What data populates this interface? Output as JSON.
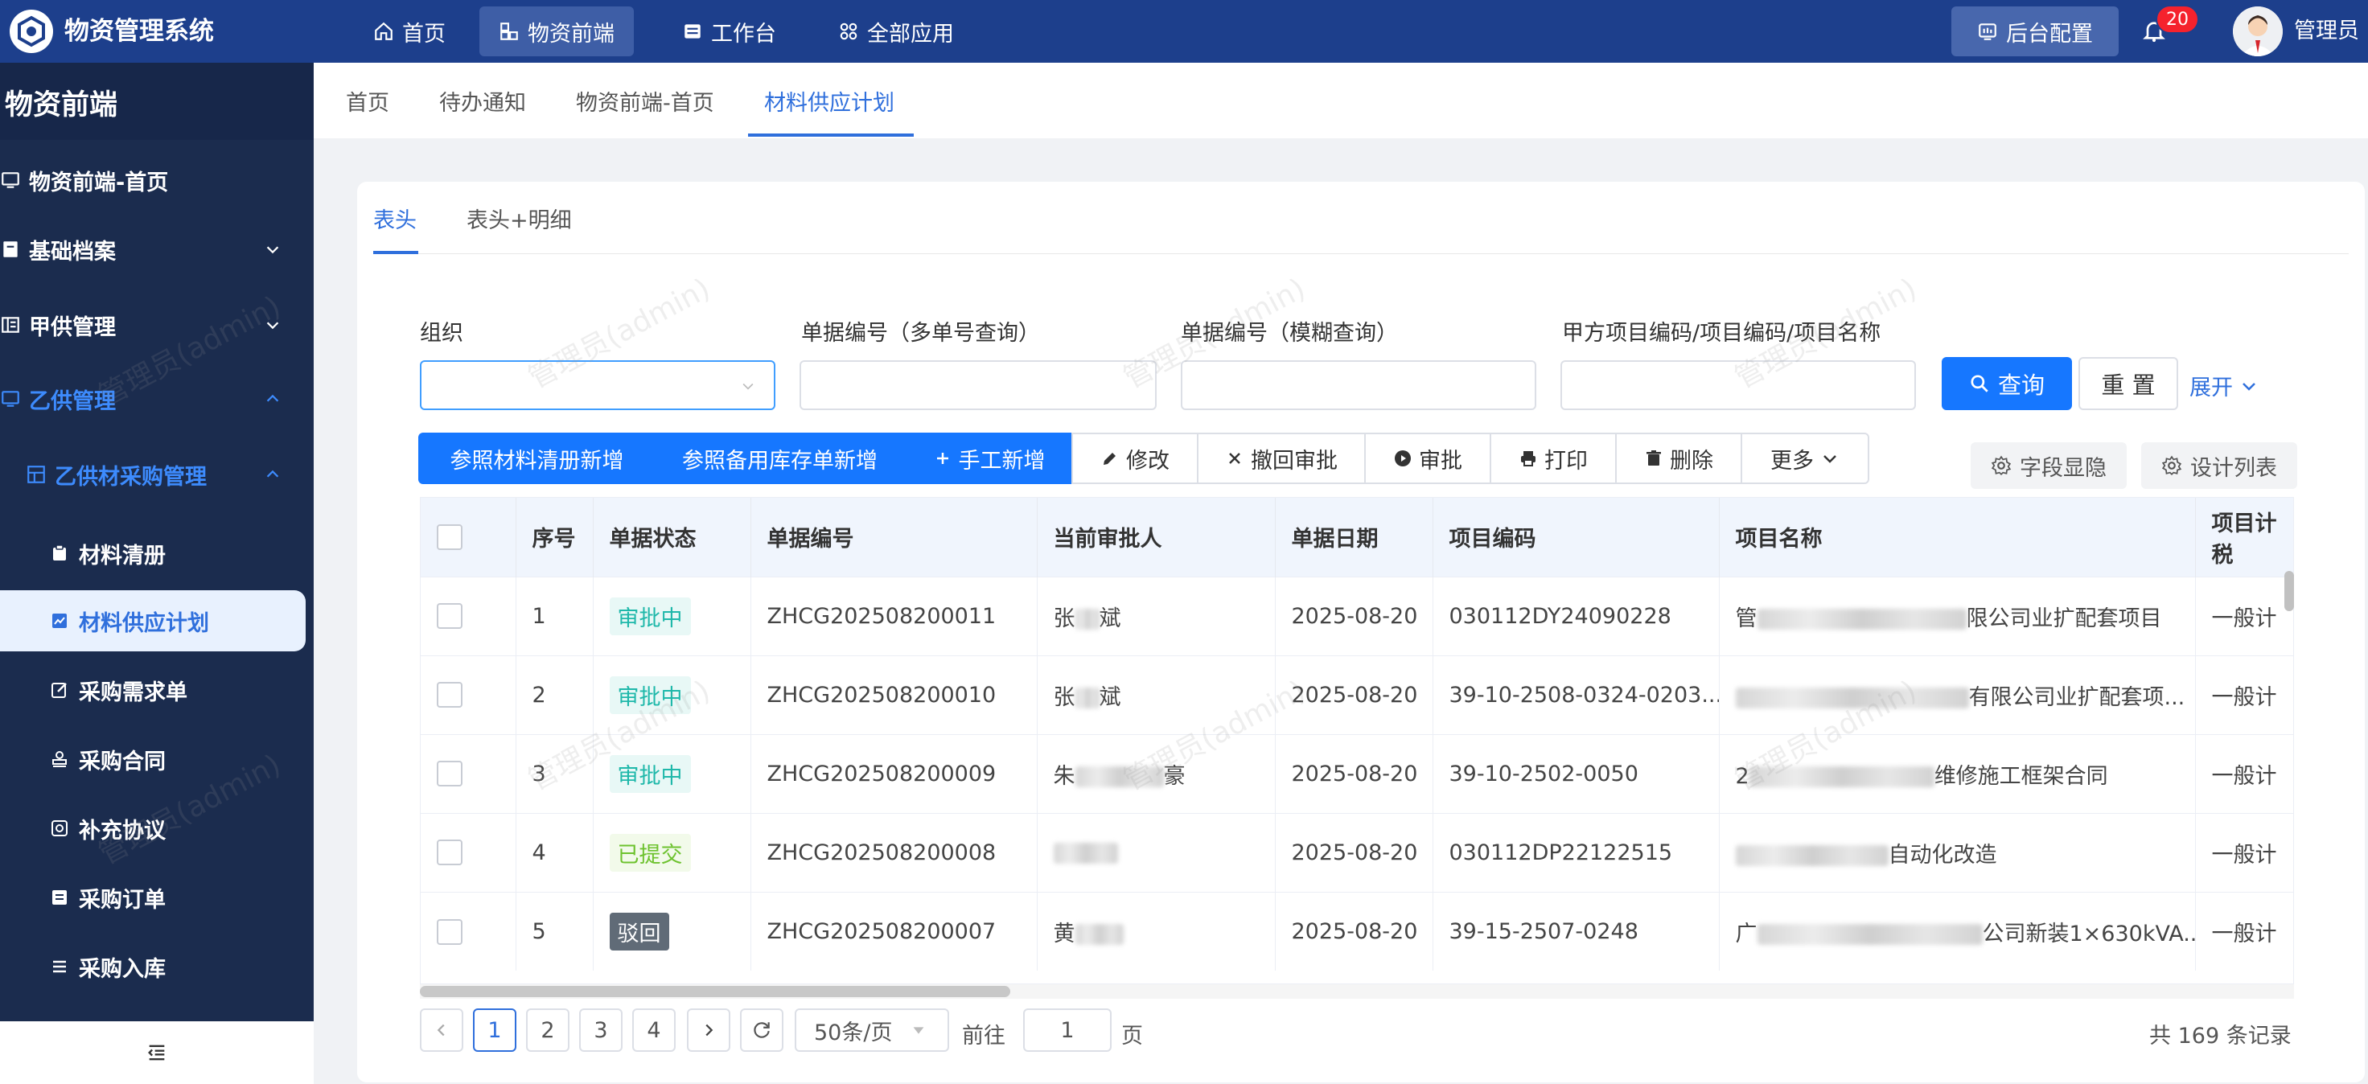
{
  "header": {
    "app_title": "物资管理系统",
    "nav": [
      {
        "label": "首页",
        "icon": "home-icon"
      },
      {
        "label": "物资前端",
        "icon": "package-icon"
      },
      {
        "label": "工作台",
        "icon": "monitor-icon"
      },
      {
        "label": "全部应用",
        "icon": "apps-icon"
      }
    ],
    "backend_config": "后台配置",
    "notification_count": "20",
    "user_name": "管理员"
  },
  "sidebar": {
    "title": "物资前端",
    "items": [
      {
        "label": "物资前端-首页",
        "icon": "monitor-icon"
      },
      {
        "label": "基础档案",
        "icon": "archive-icon"
      },
      {
        "label": "甲供管理",
        "icon": "list-icon"
      },
      {
        "label": "乙供管理",
        "icon": "monitor-icon"
      },
      {
        "label": "乙供材采购管理",
        "icon": "grid-icon"
      }
    ],
    "subitems": [
      {
        "label": "材料清册",
        "icon": "clipboard-icon"
      },
      {
        "label": "材料供应计划",
        "icon": "chart-icon"
      },
      {
        "label": "采购需求单",
        "icon": "edit-icon"
      },
      {
        "label": "采购合同",
        "icon": "stamp-icon"
      },
      {
        "label": "补充协议",
        "icon": "target-icon"
      },
      {
        "label": "采购订单",
        "icon": "order-icon"
      },
      {
        "label": "采购入库",
        "icon": "list-icon"
      }
    ]
  },
  "breadcrumbs": [
    "首页",
    "待办通知",
    "物资前端-首页",
    "材料供应计划"
  ],
  "subtabs": [
    "表头",
    "表头+明细"
  ],
  "filters": {
    "org_label": "组织",
    "doc_no_multi_label": "单据编号（多单号查询）",
    "doc_no_fuzzy_label": "单据编号（模糊查询）",
    "project_label": "甲方项目编码/项目编码/项目名称",
    "search_button": "查询",
    "reset_button": "重 置",
    "expand_link": "展开"
  },
  "toolbar": {
    "ref_list_add": "参照材料清册新增",
    "ref_stock_add": "参照备用库存单新增",
    "manual_add": "手工新增",
    "edit": "修改",
    "revoke": "撤回审批",
    "approve": "审批",
    "print": "打印",
    "delete": "删除",
    "more": "更多",
    "field_display": "字段显隐",
    "design_list": "设计列表"
  },
  "table": {
    "columns": [
      "序号",
      "单据状态",
      "单据编号",
      "当前审批人",
      "单据日期",
      "项目编码",
      "项目名称",
      "项目计税"
    ],
    "rows": [
      {
        "no": "1",
        "status": "审批中",
        "status_type": "pending",
        "doc_no": "ZHCG202508200011",
        "approver_pre": "张",
        "approver_post": "斌",
        "date": "2025-08-20",
        "project_code": "030112DY24090228",
        "project_pre": "管",
        "project_post": "限公司业扩配套项目",
        "tax": "一般计"
      },
      {
        "no": "2",
        "status": "审批中",
        "status_type": "pending",
        "doc_no": "ZHCG202508200010",
        "approver_pre": "张",
        "approver_post": "斌",
        "date": "2025-08-20",
        "project_code": "39-10-2508-0324-0203...",
        "project_pre": "",
        "project_post": "有限公司业扩配套项...",
        "tax": "一般计"
      },
      {
        "no": "3",
        "status": "审批中",
        "status_type": "pending",
        "doc_no": "ZHCG202508200009",
        "approver_pre": "朱",
        "approver_post": "豪",
        "date": "2025-08-20",
        "project_code": "39-10-2502-0050",
        "project_pre": "2",
        "project_post": "维修施工框架合同",
        "tax": "一般计"
      },
      {
        "no": "4",
        "status": "已提交",
        "status_type": "submitted",
        "doc_no": "ZHCG202508200008",
        "approver_pre": "",
        "approver_post": "",
        "date": "2025-08-20",
        "project_code": "030112DP22122515",
        "project_pre": "",
        "project_post": "自动化改造",
        "tax": "一般计"
      },
      {
        "no": "5",
        "status": "驳回",
        "status_type": "rejected",
        "doc_no": "ZHCG202508200007",
        "approver_pre": "黄",
        "approver_post": "",
        "date": "2025-08-20",
        "project_code": "39-15-2507-0248",
        "project_pre": "广",
        "project_post": "公司新装1×630kVA...",
        "tax": "一般计"
      }
    ]
  },
  "pagination": {
    "pages": [
      "1",
      "2",
      "3",
      "4"
    ],
    "page_size": "50条/页",
    "goto_prefix": "前往",
    "goto_value": "1",
    "goto_suffix": "页",
    "total": "共 169 条记录"
  },
  "watermark": "管理员(admin)",
  "colors": {
    "topbar": "#1d3f8c",
    "sidebar": "#1b2c4e",
    "primary": "#1677ff"
  }
}
